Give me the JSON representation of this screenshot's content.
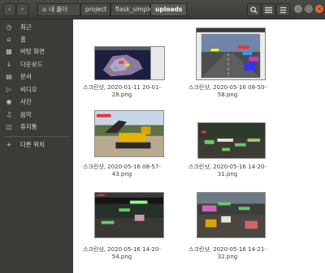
{
  "titlebar": {
    "back_icon": "chevron-left-icon",
    "forward_icon": "chevron-right-icon",
    "breadcrumbs": [
      {
        "label": "내 폴더",
        "icon": "home-icon"
      },
      {
        "label": "project"
      },
      {
        "label": "flask_simple"
      },
      {
        "label": "uploads"
      }
    ],
    "tools": [
      "search-icon",
      "list-view-icon",
      "menu-icon"
    ],
    "window_controls": [
      "minimize-icon",
      "maximize-icon",
      "close-icon"
    ]
  },
  "sidebar": {
    "items": [
      {
        "label": "최근",
        "icon": "clock-icon"
      },
      {
        "label": "홈",
        "icon": "home-icon"
      },
      {
        "label": "바탕 화면",
        "icon": "desktop-icon"
      },
      {
        "label": "다운로드",
        "icon": "download-icon"
      },
      {
        "label": "문서",
        "icon": "document-icon"
      },
      {
        "label": "비디오",
        "icon": "video-icon"
      },
      {
        "label": "사진",
        "icon": "camera-icon"
      },
      {
        "label": "음악",
        "icon": "music-icon"
      },
      {
        "label": "휴지통",
        "icon": "trash-icon"
      },
      {
        "label": "다른 위치",
        "icon": "plus-icon"
      }
    ]
  },
  "files": [
    {
      "line1": "스크린샷, 2020-01-11 20-01-",
      "line2": "28.png"
    },
    {
      "line1": "스크린샷, 2020-05-16 08-50-",
      "line2": "58.png"
    },
    {
      "line1": "스크린샷, 2020-05-16 08-57-",
      "line2": "43.png"
    },
    {
      "line1": "스크린샷, 2020-05-16 14-20-",
      "line2": "31.png"
    },
    {
      "line1": "스크린샷, 2020-05-16 14-20-",
      "line2": "54.png"
    },
    {
      "line1": "스크린샷, 2020-05-16 14-21-",
      "line2": "32.png"
    }
  ]
}
